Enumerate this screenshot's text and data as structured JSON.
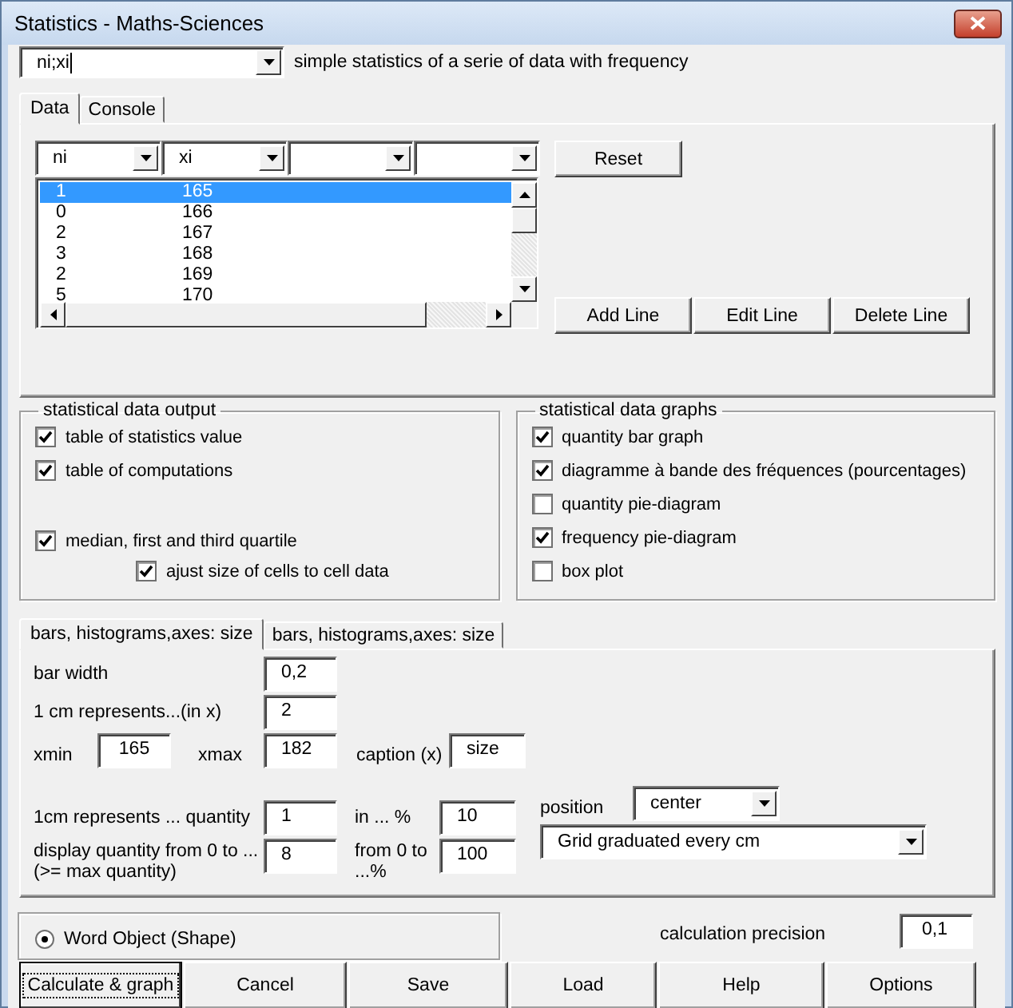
{
  "window": {
    "title": "Statistics - Maths-Sciences"
  },
  "mode_combo": {
    "value": "ni;xi",
    "caret": true
  },
  "description": "simple statistics of a serie of data with frequency",
  "tabs": [
    {
      "label": "Data",
      "selected": true
    },
    {
      "label": "Console",
      "selected": false
    }
  ],
  "column_selectors": [
    {
      "kind": "filled",
      "value": "ni"
    },
    {
      "kind": "filled",
      "value": "xi"
    },
    {
      "kind": "blank"
    },
    {
      "kind": "blank"
    }
  ],
  "rows": [
    {
      "ni": "1",
      "xi": "165",
      "selected": true
    },
    {
      "ni": "0",
      "xi": "166",
      "selected": false
    },
    {
      "ni": "2",
      "xi": "167",
      "selected": false
    },
    {
      "ni": "3",
      "xi": "168",
      "selected": false
    },
    {
      "ni": "2",
      "xi": "169",
      "selected": false
    },
    {
      "ni": "5",
      "xi": "170",
      "selected": false
    }
  ],
  "reset_button": "Reset",
  "line_buttons": [
    "Add Line",
    "Edit Line",
    "Delete Line"
  ],
  "output_group": {
    "title": "statistical data output",
    "options": [
      {
        "label": "table of statistics value",
        "checked": true
      },
      {
        "label": "table of computations",
        "checked": true
      },
      {
        "label": "median, first and third quartile",
        "checked": true,
        "children": [
          {
            "label": "ajust size of cells to cell data",
            "checked": true
          }
        ]
      }
    ]
  },
  "graphs_group": {
    "title": "statistical data graphs",
    "options": [
      {
        "label": "quantity bar graph",
        "checked": true
      },
      {
        "label": "diagramme à bande des fréquences (pourcentages)",
        "checked": true
      },
      {
        "label": "quantity pie-diagram",
        "checked": false
      },
      {
        "label": "frequency pie-diagram",
        "checked": true
      },
      {
        "label": "box plot",
        "checked": false
      }
    ]
  },
  "settings_tabs": [
    {
      "label": "bars, histograms,axes: size",
      "selected": true
    },
    {
      "label": "bars, histograms,axes: size",
      "selected": false
    }
  ],
  "settings": {
    "bar_width": {
      "label": "bar width",
      "value": "0,2"
    },
    "x_scale": {
      "label": "1 cm represents...(in x)",
      "value": "2"
    },
    "xmin": {
      "label": "xmin",
      "value": "165"
    },
    "xmax": {
      "label": "xmax",
      "value": "182"
    },
    "caption_x": {
      "label": "caption (x)",
      "value": "size"
    },
    "quantity_scale": {
      "label": "1cm represents ... quantity",
      "value": "1"
    },
    "percent_scale": {
      "label": "in ... %",
      "value": "10"
    },
    "quantity_max": {
      "label": "display quantity from 0 to ... (>= max quantity)",
      "value": "8"
    },
    "percent_max": {
      "label": "from 0 to ...%",
      "value": "100"
    },
    "position": {
      "label": "position",
      "value": "center"
    },
    "grid": {
      "value": "Grid graduated every cm"
    }
  },
  "output_object": {
    "label": "Word Object (Shape)",
    "selected": true
  },
  "precision": {
    "label": "calculation precision",
    "value": "0,1"
  },
  "buttons": [
    {
      "label": "Calculate & graph",
      "focused": true
    },
    {
      "label": "Cancel",
      "focused": false
    },
    {
      "label": "Save",
      "focused": false
    },
    {
      "label": "Load",
      "focused": false
    },
    {
      "label": "Help",
      "focused": false
    },
    {
      "label": "Options",
      "focused": false
    }
  ]
}
